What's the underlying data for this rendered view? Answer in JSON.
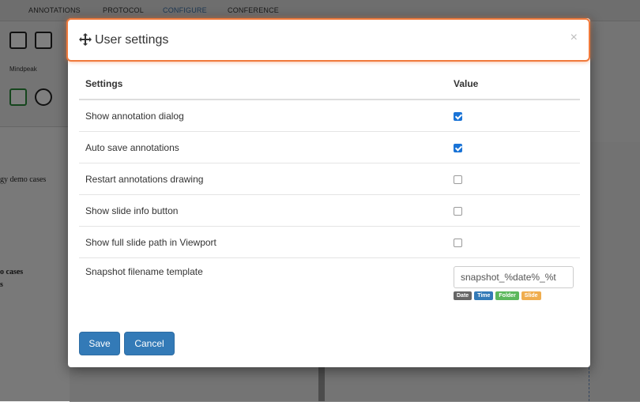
{
  "background_app": {
    "menu": [
      "ANNOTATIONS",
      "PROTOCOL",
      "CONFIGURE",
      "CONFERENCE"
    ],
    "tool_label": "Mindpeak",
    "left_texts": [
      "gy demo cases",
      "o cases",
      "s"
    ]
  },
  "modal": {
    "title": "User settings",
    "close": "×",
    "headers": {
      "settings": "Settings",
      "value": "Value"
    },
    "rows": [
      {
        "label": "Show annotation dialog",
        "checked": true
      },
      {
        "label": "Auto save annotations",
        "checked": true
      },
      {
        "label": "Restart annotations drawing",
        "checked": false
      },
      {
        "label": "Show slide info button",
        "checked": false
      },
      {
        "label": "Show full slide path in Viewport",
        "checked": false
      }
    ],
    "snapshot": {
      "label": "Snapshot filename template",
      "value": "snapshot_%date%_%t",
      "tags": [
        {
          "text": "Date",
          "color": "#666666"
        },
        {
          "text": "Time",
          "color": "#337ab7"
        },
        {
          "text": "Folder",
          "color": "#5cb85c"
        },
        {
          "text": "Slide",
          "color": "#f0ad4e"
        }
      ]
    },
    "buttons": {
      "save": "Save",
      "cancel": "Cancel"
    }
  },
  "colors": {
    "accent": "#337ab7",
    "header_border": "#f07a3c",
    "checkbox": "#1a73d6"
  }
}
